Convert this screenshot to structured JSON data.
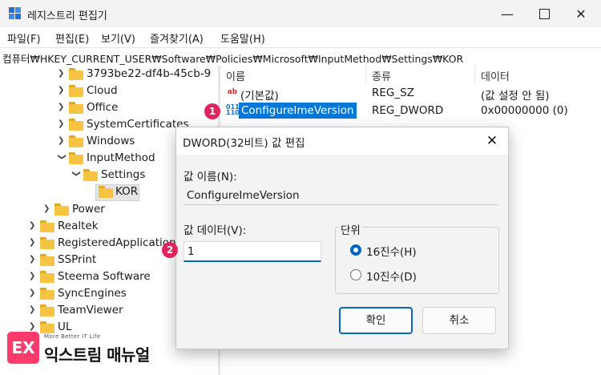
{
  "window": {
    "title": "레지스트리 편집기"
  },
  "menu": [
    "파일(F)",
    "편집(E)",
    "보기(V)",
    "즐겨찾기(A)",
    "도움말(H)"
  ],
  "address": "컴퓨터₩HKEY_CURRENT_USER₩Software₩Policies₩Microsoft₩InputMethod₩Settings₩KOR",
  "tree": [
    "3793be22-df4b-45cb-9",
    "Cloud",
    "Office",
    "SystemCertificates",
    "Windows",
    "InputMethod",
    "Settings",
    "KOR",
    "Power",
    "Realtek",
    "RegisteredApplication",
    "SSPrint",
    "Steema Software",
    "SyncEngines",
    "TeamViewer",
    "UL"
  ],
  "list": {
    "columns": [
      "이름",
      "종류",
      "데이터"
    ],
    "rows": [
      {
        "icon": "string-value-icon",
        "name": "(기본값)",
        "type": "REG_SZ",
        "data": "(값 설정 안 됨)"
      },
      {
        "icon": "dword-value-icon",
        "name": "ConfigureImeVersion",
        "type": "REG_DWORD",
        "data": "0x00000000 (0)",
        "badge": "1"
      }
    ]
  },
  "dialog": {
    "title": "DWORD(32비트) 값 편집",
    "name_label": "값 이름(N):",
    "name_value": "ConfigureImeVersion",
    "data_label": "값 데이터(V):",
    "data_value": "1",
    "data_badge": "2",
    "base_label": "단위",
    "hex_label": "16진수(H)",
    "dec_label": "10진수(D)",
    "base_selected": "hex",
    "ok_label": "확인",
    "cancel_label": "취소"
  },
  "brand": {
    "logo_text": "EX",
    "tagline": "More Better IT Life",
    "name": "익스트림 매뉴얼"
  },
  "colors": {
    "accent": "#0067c0",
    "badge": "#e0245e",
    "folder": "#f6c343",
    "selection": "#0078d7",
    "brand": "#ff3b6b"
  }
}
